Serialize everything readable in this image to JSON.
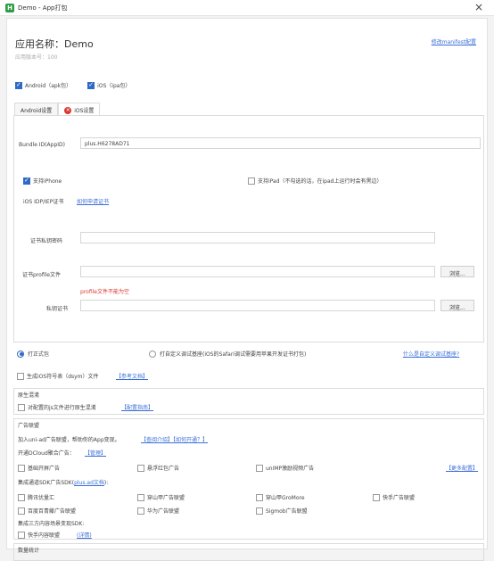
{
  "window": {
    "title": "Demo - App打包",
    "icon_letter": "H"
  },
  "app": {
    "name": "应用名称：Demo",
    "version": "应用版本号：100"
  },
  "links": {
    "manifest": "修改manifest配置"
  },
  "platforms": [
    {
      "label": "Android（apk包）",
      "checked": true
    },
    {
      "label": "iOS（ipa包）",
      "checked": true
    }
  ],
  "tabs": [
    {
      "label": "Android设置",
      "active": false,
      "error": false
    },
    {
      "label": "iOS设置",
      "active": true,
      "error": true
    }
  ],
  "ios": {
    "bundle_label": "Bundle ID(AppID)",
    "bundle_value": "plus.H6278AD71",
    "support_iphone": "支持iPhone",
    "support_ipad": "支持iPad（不勾选的话，在ipad上运行时会有黑边）",
    "cert_row_label": "iOS IDP/IEP证书",
    "cert_howto": "如何申请证书",
    "private_key_label": "证书私钥密码",
    "profile_label": "证书profile文件",
    "profile_error": "profile文件不能为空",
    "private_cert_label": "私钥证书",
    "browse": "浏览..."
  },
  "build": {
    "formal": "打正式包",
    "custom_debug": "打自定义调试基座(iOS的Safari调试需要用苹果开发证书打包)",
    "custom_debug_help": "什么是自定义调试基座?",
    "dsym": "生成iOS符号表（dsym）文件",
    "dsym_ref": "【参考文档】"
  },
  "obfuscate": {
    "title": "原生混淆",
    "item": "对配置的js文件进行原生混淆",
    "config_guide": "【配置指南】"
  },
  "ads": {
    "title": "广告联盟",
    "intro": "加入uni-ad广告联盟，帮助你的App变现。",
    "intro_links": "【查阅介绍】【如何开通？】",
    "dcloud_label": "开通DCloud聚合广告：",
    "manage": "【管理】",
    "more_config": "【更多配置】",
    "dcloud_items": [
      "基础开屏广告",
      "悬浮红包广告",
      "uniMP激励视频广告"
    ],
    "sdk_label": "集成通道SDK广告SDK(",
    "sdk_link": "plus.ad文档",
    "sdk_label_end": "):",
    "sdk_items": [
      "腾讯优量汇",
      "穿山甲广告联盟",
      "穿山甲GroMore",
      "快手广告联盟",
      "百度百青藤广告联盟",
      "华为广告联盟",
      "Sigmob广告联盟"
    ],
    "content_label": "集成三方内容场景变现SDK:",
    "content_item": "快手内容联盟",
    "content_link": "(详情)"
  },
  "stats": {
    "title": "数量统计"
  }
}
